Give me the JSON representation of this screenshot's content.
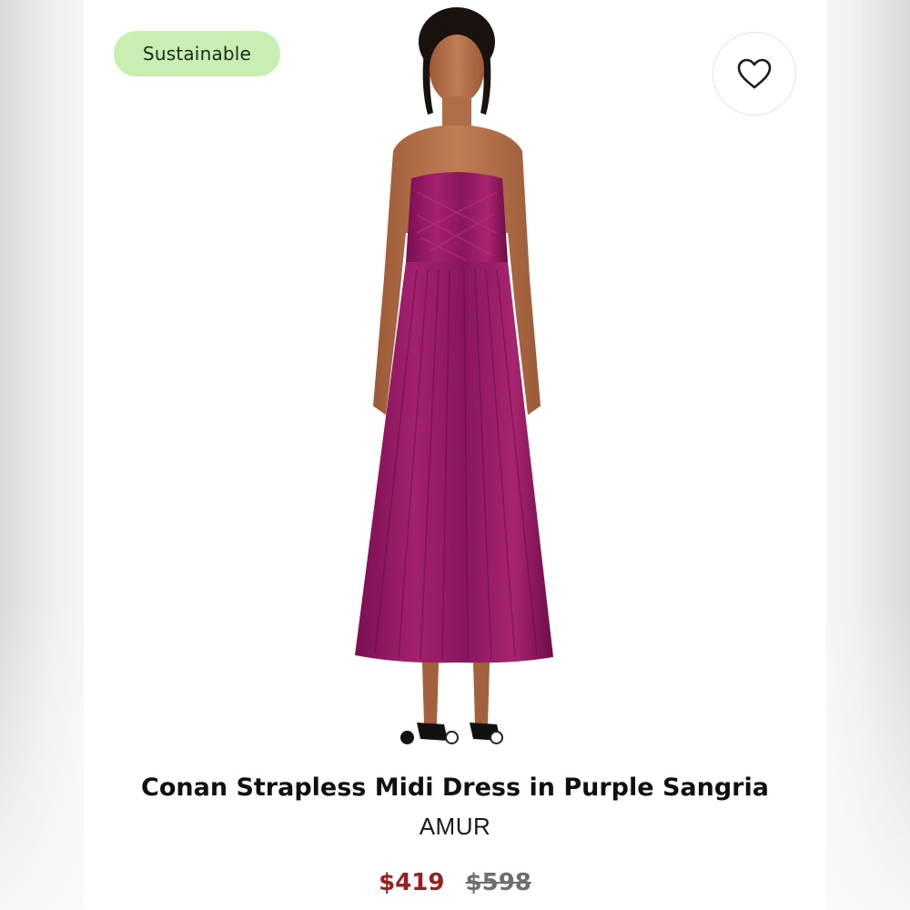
{
  "badge": {
    "label": "Sustainable"
  },
  "favorite": {
    "icon": "heart-outline-icon"
  },
  "gallery": {
    "image": "strapless-pleated-midi-dress-photo",
    "dot_count": 3,
    "active_index": 0
  },
  "product": {
    "title": "Conan Strapless Midi Dress in Purple Sangria",
    "brand": "AMUR",
    "sale_price": "$419",
    "original_price": "$598"
  },
  "colors": {
    "badge_bg": "#c9eeb2",
    "sale_price": "#9a1f1f",
    "dress": "#8e1560"
  }
}
